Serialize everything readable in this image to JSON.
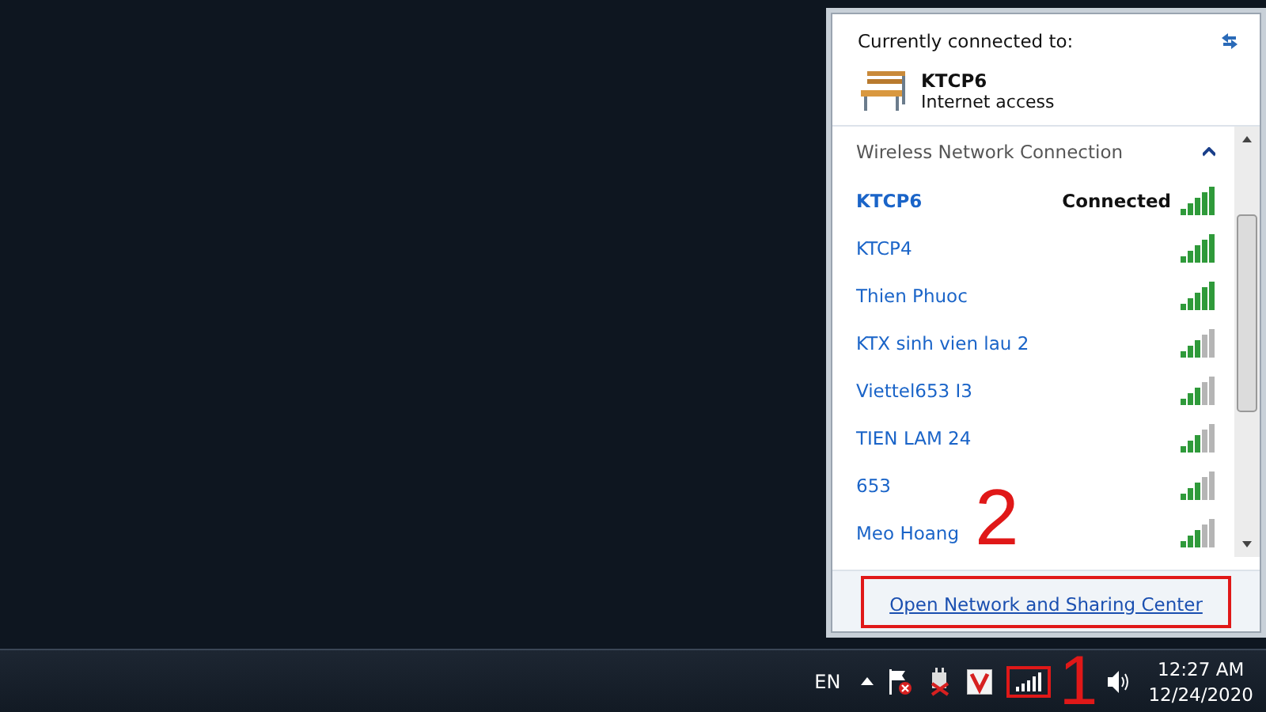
{
  "flyout": {
    "heading": "Currently connected to:",
    "current": {
      "name": "KTCP6",
      "status": "Internet access"
    },
    "section": {
      "title": "Wireless Network Connection",
      "expanded": true
    },
    "networks": [
      {
        "name": "KTCP6",
        "connected": true,
        "status": "Connected",
        "strong": true
      },
      {
        "name": "KTCP4",
        "connected": false,
        "strong": true
      },
      {
        "name": "Thien Phuoc",
        "connected": false,
        "strong": true
      },
      {
        "name": "KTX sinh vien lau 2",
        "connected": false,
        "strong": false
      },
      {
        "name": "Viettel653 I3",
        "connected": false,
        "strong": false
      },
      {
        "name": "TIEN LAM 24",
        "connected": false,
        "strong": false
      },
      {
        "name": "653",
        "connected": false,
        "strong": false
      },
      {
        "name": "Meo Hoang",
        "connected": false,
        "strong": false
      }
    ],
    "link": "Open Network and Sharing Center"
  },
  "taskbar": {
    "language": "EN",
    "time": "12:27 AM",
    "date": "12/24/2020"
  },
  "annotations": [
    {
      "label": "2"
    },
    {
      "label": "1"
    }
  ]
}
